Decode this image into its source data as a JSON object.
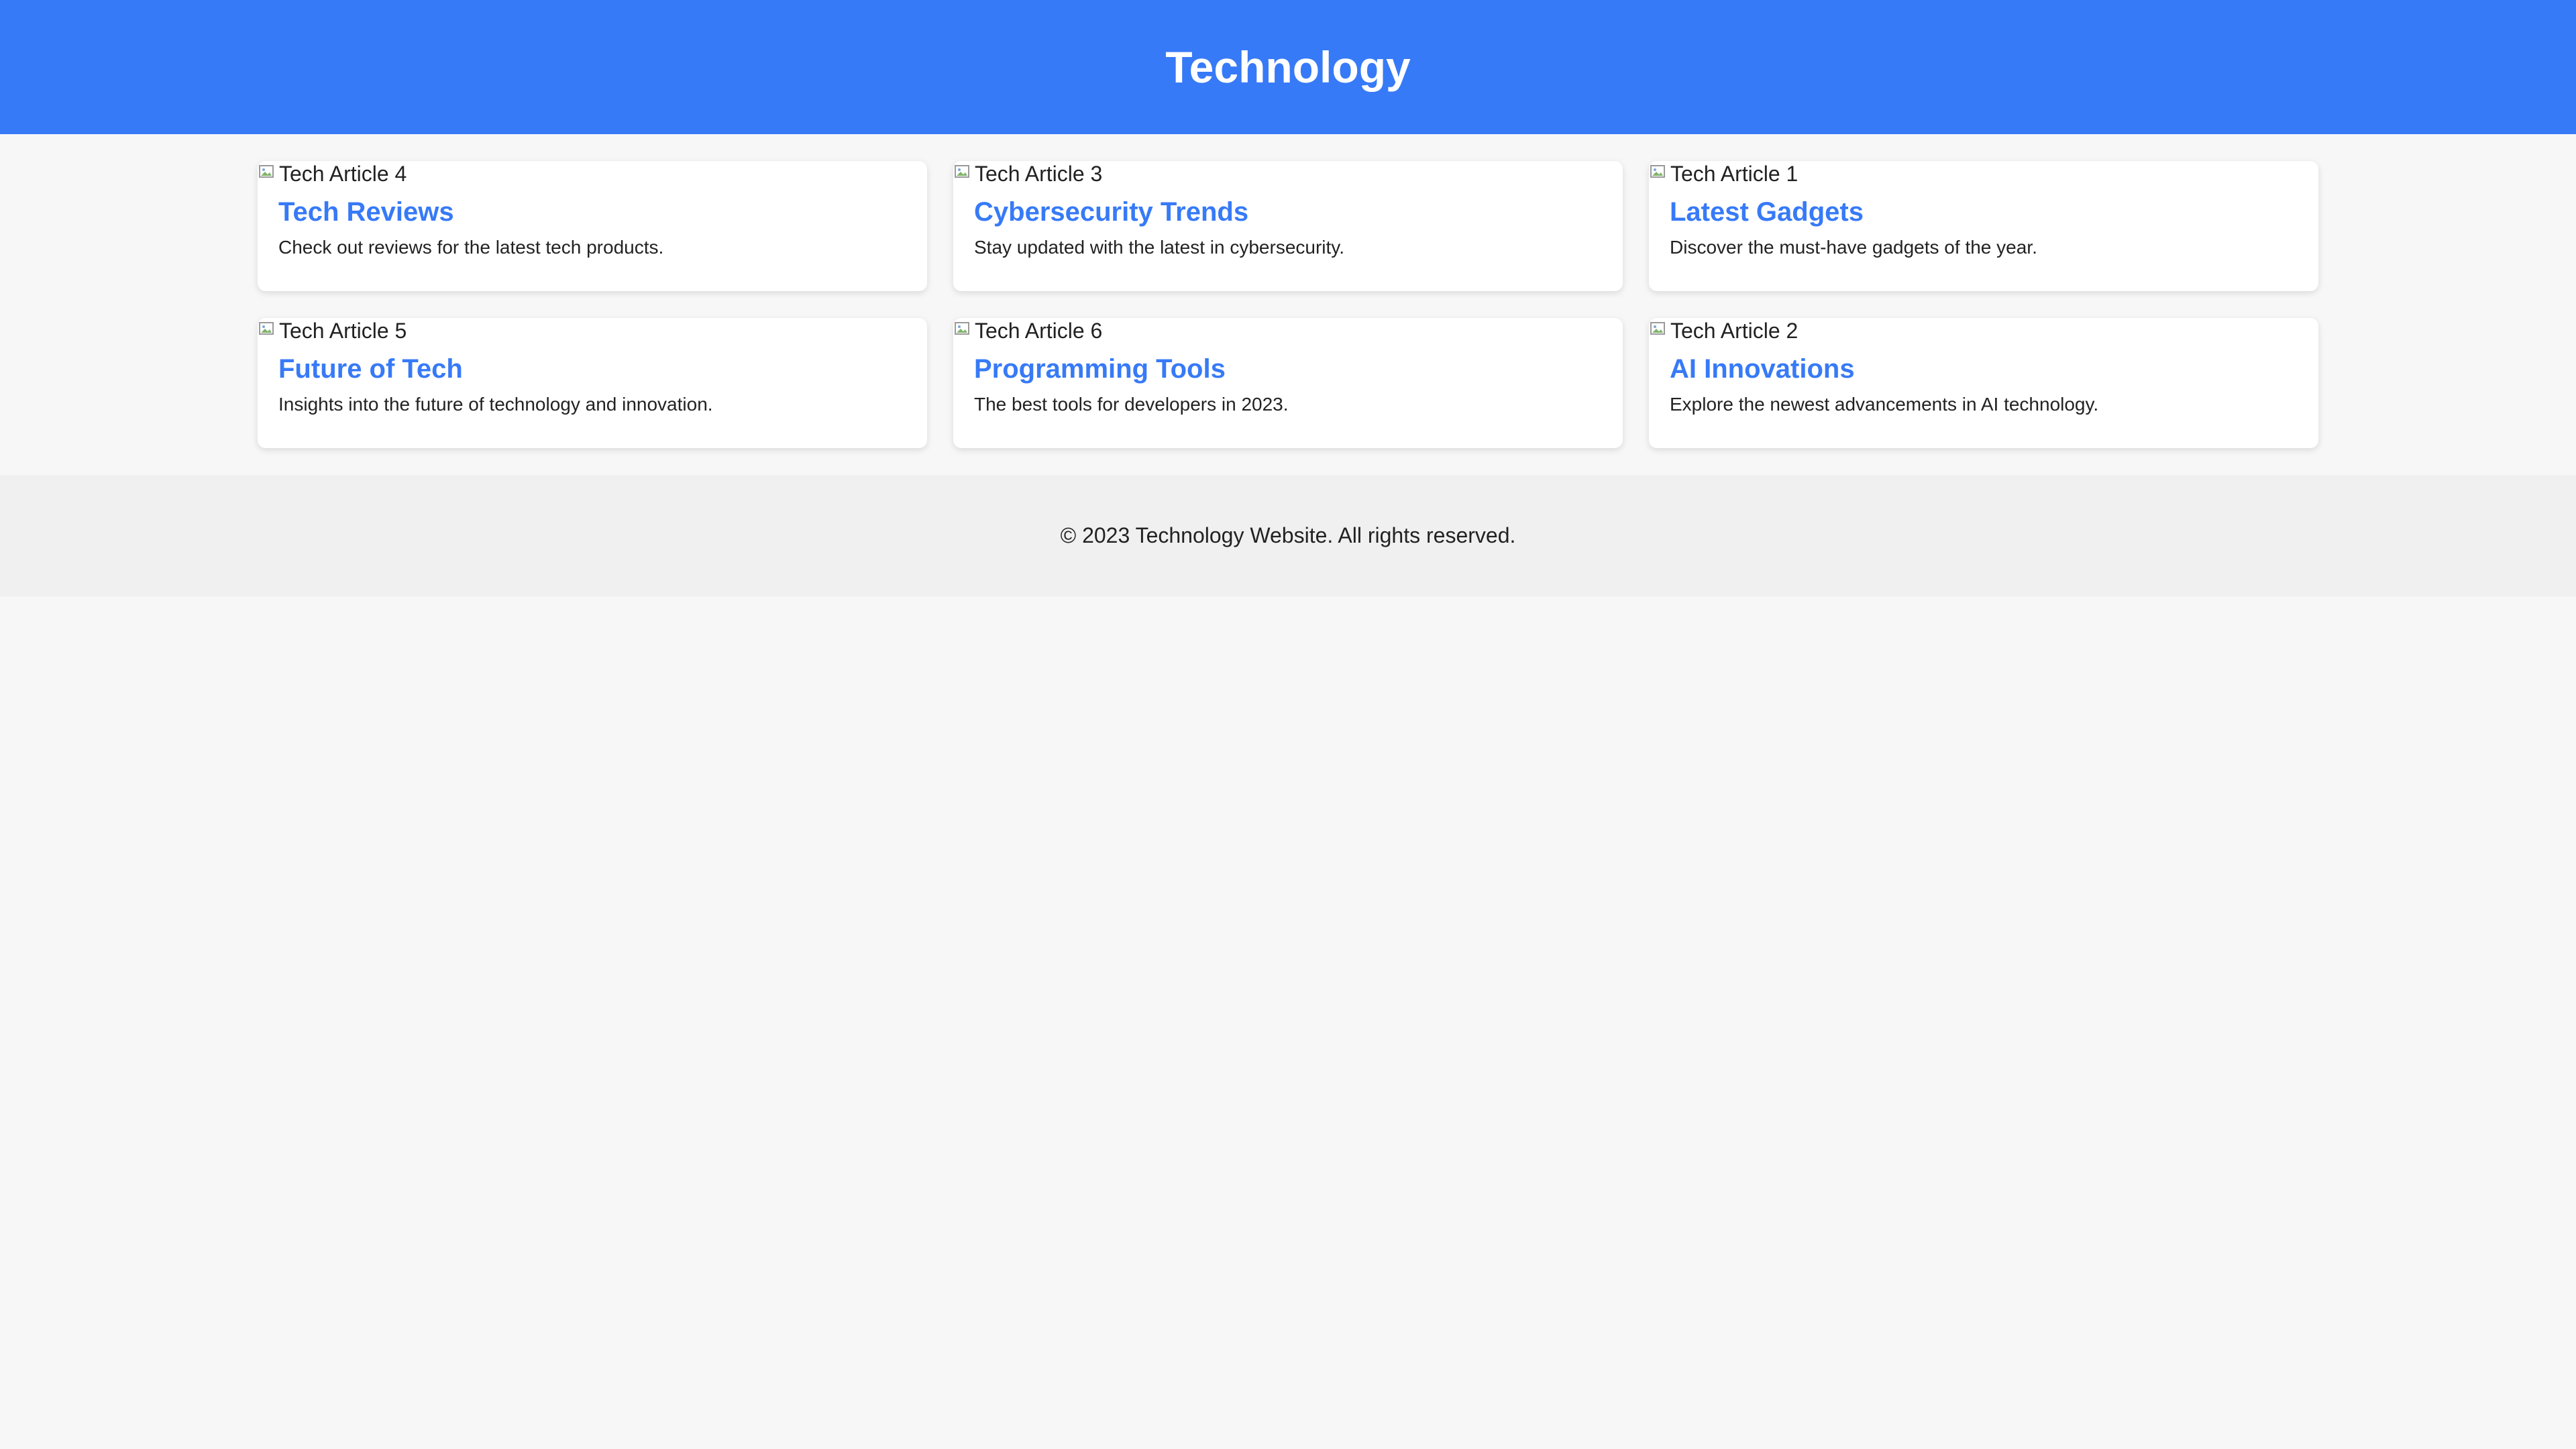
{
  "header": {
    "title": "Technology",
    "background_color": "#377af7"
  },
  "articles": [
    {
      "image_alt": "Tech Article 4",
      "title": "Tech Reviews",
      "description": "Check out reviews for the latest tech products."
    },
    {
      "image_alt": "Tech Article 3",
      "title": "Cybersecurity Trends",
      "description": "Stay updated with the latest in cybersecurity."
    },
    {
      "image_alt": "Tech Article 1",
      "title": "Latest Gadgets",
      "description": "Discover the must-have gadgets of the year."
    },
    {
      "image_alt": "Tech Article 5",
      "title": "Future of Tech",
      "description": "Insights into the future of technology and innovation."
    },
    {
      "image_alt": "Tech Article 6",
      "title": "Programming Tools",
      "description": "The best tools for developers in 2023."
    },
    {
      "image_alt": "Tech Article 2",
      "title": "AI Innovations",
      "description": "Explore the newest advancements in AI technology."
    }
  ],
  "footer": {
    "text": "© 2023 Technology Website. All rights reserved."
  },
  "colors": {
    "accent": "#377af7",
    "page_background": "#f7f7f7",
    "footer_background": "#f0f0f0"
  },
  "icons": {
    "image_placeholder": "broken-image-icon"
  }
}
